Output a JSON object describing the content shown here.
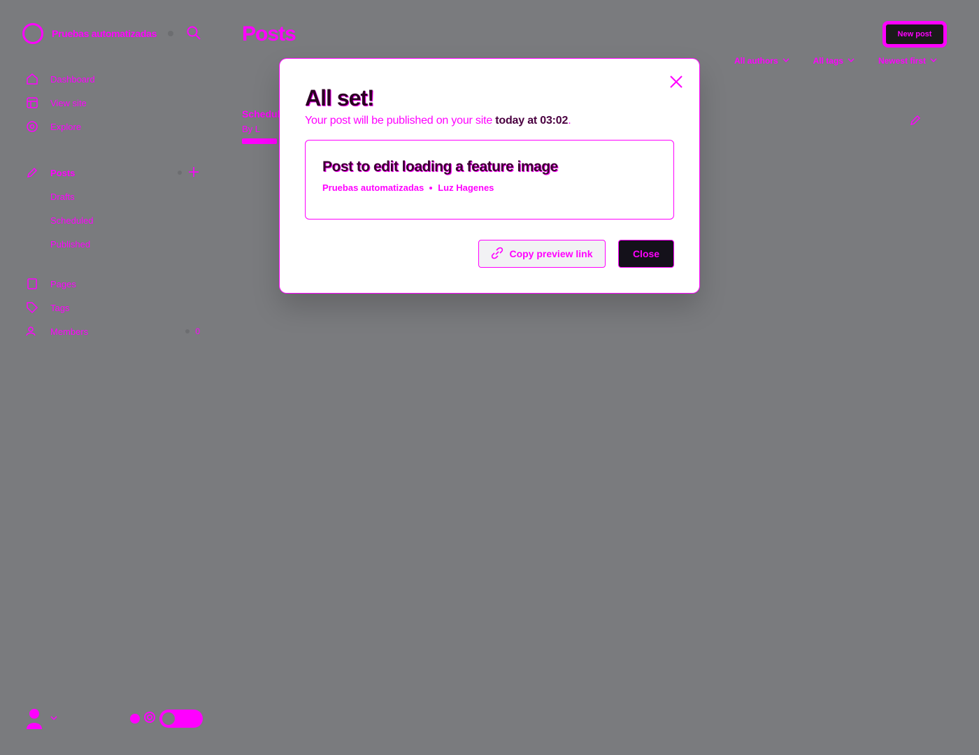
{
  "sidebar": {
    "site_name": "Pruebas automatizadas",
    "nav_main": [
      {
        "label": "Dashboard",
        "icon": "home-icon"
      },
      {
        "label": "View site",
        "icon": "view-site-icon"
      },
      {
        "label": "Explore",
        "icon": "explore-icon"
      }
    ],
    "posts": {
      "label": "Posts",
      "icon": "pen-icon"
    },
    "posts_sub": [
      {
        "label": "Drafts"
      },
      {
        "label": "Scheduled"
      },
      {
        "label": "Published"
      }
    ],
    "nav_secondary": [
      {
        "label": "Pages",
        "icon": "page-icon"
      },
      {
        "label": "Tags",
        "icon": "tag-icon"
      },
      {
        "label": "Members",
        "icon": "members-icon",
        "count": "0"
      }
    ]
  },
  "header": {
    "title": "Posts",
    "new_post_label": "New post"
  },
  "filters": [
    "All authors",
    "All tags",
    "Newest first"
  ],
  "post_row": {
    "title": "Scheduled",
    "meta": "By L"
  },
  "modal": {
    "title": "All set!",
    "desc_prefix": "Your post will be published on your site ",
    "desc_when": "today at 03:02",
    "desc_suffix": ".",
    "card_title": "Post to edit loading a feature image",
    "card_site": "Pruebas automatizadas",
    "card_author": "Luz Hagenes",
    "copy_label": "Copy preview link",
    "close_label": "Close"
  },
  "colors": {
    "accent": "#ff00ff",
    "backdrop": "#7a7b7e",
    "modal_bg": "#ffffff",
    "dark_button": "#14111a"
  }
}
